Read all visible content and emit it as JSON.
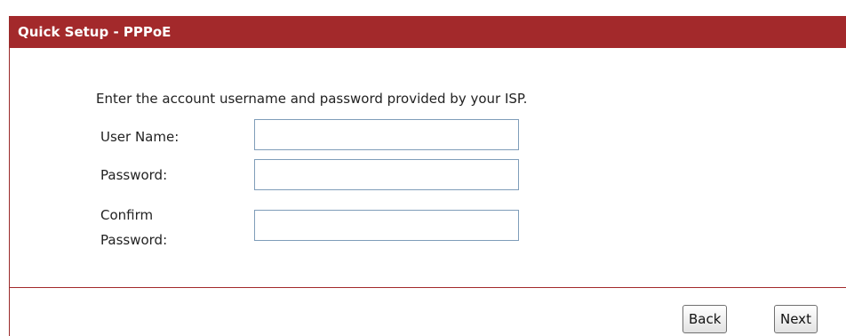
{
  "header": {
    "title": "Quick Setup - PPPoE"
  },
  "form": {
    "intro": "Enter the account username and password provided by your ISP.",
    "username": {
      "label": "User Name:",
      "value": ""
    },
    "password": {
      "label": "Password:",
      "value": ""
    },
    "confirm": {
      "label_line1": "Confirm",
      "label_line2": "Password:",
      "value": ""
    }
  },
  "buttons": {
    "back": "Back",
    "next": "Next"
  },
  "colors": {
    "header_bg": "#a3292b",
    "header_text": "#ffffff",
    "divider": "#a3292b"
  }
}
